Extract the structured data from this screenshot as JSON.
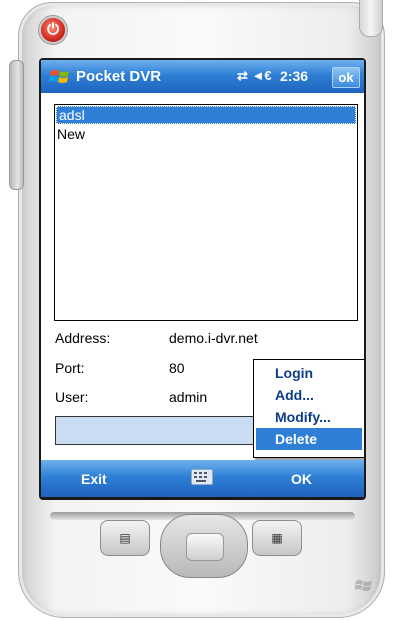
{
  "app": {
    "title": "Pocket DVR",
    "time": "2:36",
    "ok_label": "ok",
    "status_icons": "⇄ ◄€"
  },
  "list": {
    "items": [
      "adsl",
      "New"
    ],
    "selected_index": 0
  },
  "fields": {
    "address_label": "Address:",
    "address_value": "demo.i-dvr.net",
    "port_label": "Port:",
    "port_value": "80",
    "user_label": "User:",
    "user_value": "admin"
  },
  "context_menu": {
    "items": [
      "Login",
      "Add...",
      "Modify...",
      "Delete"
    ],
    "active_index": 3
  },
  "softkeys": {
    "left": "Exit",
    "right": "OK",
    "center_icon": "keyboard-icon"
  },
  "hardware": {
    "power_icon": "power-icon",
    "left_key_icon": "calendar-icon",
    "right_key_icon": "contacts-icon"
  },
  "colors": {
    "accent": "#2f7fd6",
    "power": "#d22a1e",
    "menu_text": "#0c3d8a"
  }
}
